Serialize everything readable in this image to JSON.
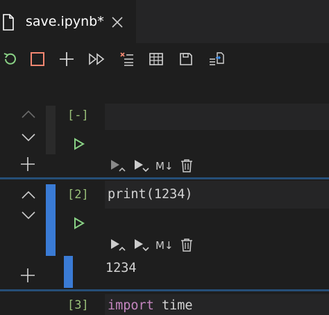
{
  "tab": {
    "filename": "save.ipynb*"
  },
  "toolbar": {
    "restart_icon": "restart-icon",
    "interrupt_icon": "stop-icon",
    "add_cell_icon": "plus-icon",
    "run_all_icon": "run-all-icon",
    "clear_outputs_icon": "clear-outputs-icon",
    "variables_icon": "table-icon",
    "save_icon": "save-icon",
    "export_icon": "export-icon"
  },
  "cells": [
    {
      "prompt": "[-]",
      "code": "",
      "markdown_label": "M↓"
    },
    {
      "prompt": "[2]",
      "code_fn": "print",
      "code_args": "(1234)",
      "output": "1234",
      "markdown_label": "M↓"
    },
    {
      "prompt": "[3]",
      "code_kw": "import",
      "code_rest": " time"
    }
  ],
  "colors": {
    "accent": "#3a7bd5",
    "run": "#89d185",
    "prompt": "#9ac27a",
    "keyword": "#c586c0",
    "separator": "#264f78"
  }
}
